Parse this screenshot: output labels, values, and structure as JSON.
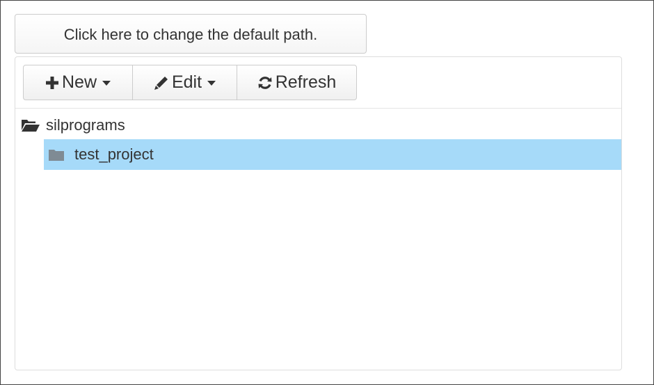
{
  "default_path_button": {
    "label": "Click here to change the default path."
  },
  "toolbar": {
    "new_label": "New",
    "edit_label": "Edit",
    "refresh_label": "Refresh",
    "icons": {
      "new": "plus-icon",
      "edit": "pencil-icon",
      "refresh": "refresh-icon"
    }
  },
  "tree": {
    "root": {
      "label": "silprograms",
      "icon": "folder-open-icon"
    },
    "children": [
      {
        "label": "test_project",
        "icon": "folder-icon",
        "selected": true
      }
    ]
  },
  "colors": {
    "selection": "#a6daf9",
    "folder_child": "#7f8b94"
  }
}
